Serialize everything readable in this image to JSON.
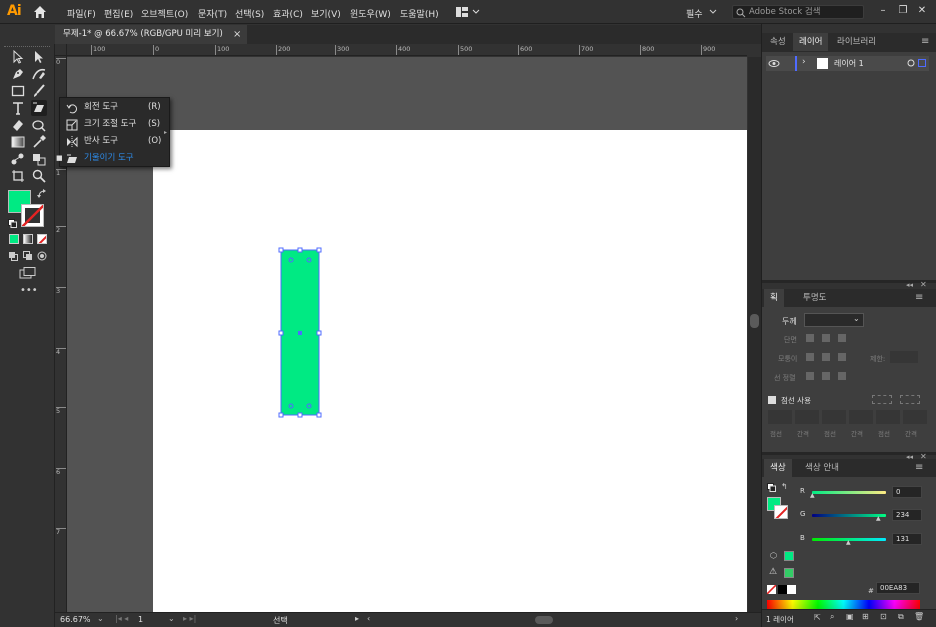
{
  "app": {
    "logo": "Ai"
  },
  "menubar": {
    "items": [
      "파일(F)",
      "편집(E)",
      "오브젝트(O)",
      "문자(T)",
      "선택(S)",
      "효과(C)",
      "보기(V)",
      "윈도우(W)",
      "도움말(H)"
    ],
    "workspace": "필수",
    "search_placeholder": "Adobe Stock 검색"
  },
  "document": {
    "tab_title": "무제-1* @ 66.67% (RGB/GPU 미리 보기)",
    "close": "×"
  },
  "rulers": {
    "h_ticks": [
      "100",
      "0",
      "100",
      "200",
      "300",
      "400",
      "500",
      "600",
      "700",
      "800",
      "900"
    ],
    "v_ticks": [
      "0",
      "1",
      "2",
      "3",
      "4",
      "5",
      "6",
      "7"
    ]
  },
  "flyout": {
    "items": [
      {
        "label": "회전 도구",
        "shortcut": "(R)",
        "icon": "rotate-icon"
      },
      {
        "label": "크기 조절 도구",
        "shortcut": "(S)",
        "icon": "scale-icon"
      },
      {
        "label": "반사 도구",
        "shortcut": "(O)",
        "icon": "reflect-icon"
      },
      {
        "label": "기울이기 도구",
        "shortcut": "",
        "icon": "shear-icon",
        "active": true
      }
    ]
  },
  "canvas": {
    "shape_fill": "#00EA83"
  },
  "statusbar": {
    "zoom": "66.67%",
    "artboard": "1",
    "tool": "선택"
  },
  "layers_panel": {
    "tabs": [
      "속성",
      "레이어",
      "라이브러리"
    ],
    "active_tab": "레이어",
    "layer_name": "레이어 1",
    "footer": "1 레이어"
  },
  "stroke_panel": {
    "tabs": [
      "획",
      "투명도"
    ],
    "weight_label": "두께",
    "cap_label": "단면",
    "corner_label": "모퉁이",
    "limit_label": "제한:",
    "align_label": "선 정렬",
    "dashed_label": "점선 사용",
    "dash_labels": [
      "점선",
      "간격",
      "점선",
      "간격",
      "점선",
      "간격"
    ]
  },
  "color_panel": {
    "tabs": [
      "색상",
      "색상 안내"
    ],
    "r": {
      "label": "R",
      "value": "0"
    },
    "g": {
      "label": "G",
      "value": "234"
    },
    "b": {
      "label": "B",
      "value": "131"
    },
    "hex_label": "#",
    "hex": "00EA83"
  },
  "colors": {
    "fill": "#00EA83",
    "accent": "#2d8ceb",
    "selection": "#4f6bff"
  }
}
